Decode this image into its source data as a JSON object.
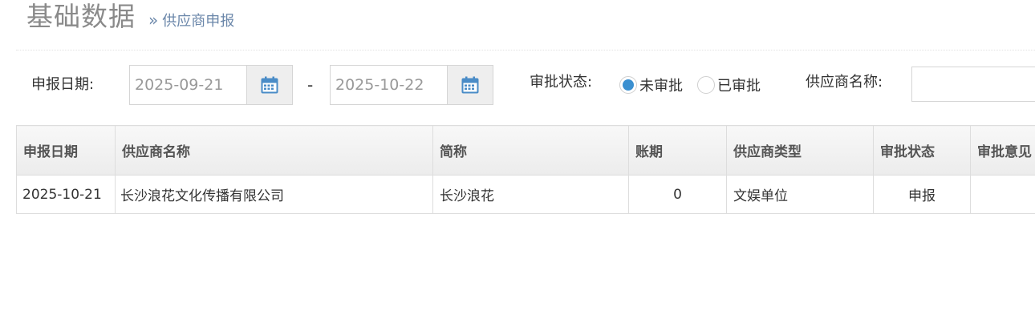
{
  "header": {
    "title": "基础数据",
    "breadcrumb_sep": "»",
    "breadcrumb": "供应商申报"
  },
  "filters": {
    "date_label": "申报日期:",
    "date_from": "2025-09-21",
    "date_to": "2025-10-22",
    "date_sep": "-",
    "status_label": "审批状态:",
    "status_options": [
      {
        "label": "未审批",
        "selected": true
      },
      {
        "label": "已审批",
        "selected": false
      }
    ],
    "supplier_label": "供应商名称:",
    "supplier_value": ""
  },
  "table": {
    "columns": [
      "申报日期",
      "供应商名称",
      "简称",
      "账期",
      "供应商类型",
      "审批状态",
      "审批意见"
    ],
    "rows": [
      [
        "2025-10-21",
        "长沙浪花文化传播有限公司",
        "长沙浪花",
        "0",
        "文娱单位",
        "申报",
        ""
      ]
    ]
  },
  "colors": {
    "accent": "#3a8fd0",
    "calendar_icon": "#4a8cc7",
    "title_gray": "#8a8a8a",
    "breadcrumb_blue": "#6b87aa"
  },
  "icons": {
    "calendar": "calendar-icon"
  }
}
